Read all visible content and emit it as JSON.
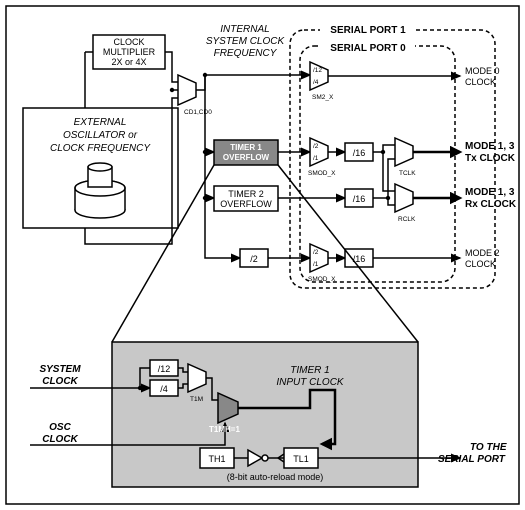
{
  "labels": {
    "clockmult1": "CLOCK",
    "clockmult2": "MULTIPLIER",
    "clockmult3": "2X or 4X",
    "cd": "CD1,CD0",
    "extosc1": "EXTERNAL",
    "extosc2": "OSCILLATOR or",
    "extosc3": "CLOCK FREQUENCY",
    "intclk1": "INTERNAL",
    "intclk2": "SYSTEM CLOCK",
    "intclk3": "FREQUENCY",
    "sp1": "SERIAL PORT 1",
    "sp0": "SERIAL PORT 0",
    "t1of1": "TIMER 1",
    "t1of2": "OVERFLOW",
    "t2of1": "TIMER 2",
    "t2of2": "OVERFLOW",
    "d12": "/12",
    "d4": "/4",
    "d2": "/2",
    "d1": "/1",
    "d16": "/16",
    "sm2x": "SM2_X",
    "smodx": "SMOD_X",
    "tclk": "TCLK",
    "rclk": "RCLK",
    "m0a": "MODE 0",
    "m0b": "CLOCK",
    "m13txa": "MODE 1, 3",
    "m13txb": "Tx CLOCK",
    "m13rxa": "MODE 1, 3",
    "m13rxb": "Rx CLOCK",
    "m2a": "MODE 2",
    "m2b": "CLOCK",
    "sysclk1": "SYSTEM",
    "sysclk2": "CLOCK",
    "oscclk1": "OSC",
    "oscclk2": "CLOCK",
    "t1m": "T1M",
    "t1mh": "T1MH=1",
    "t1in1": "TIMER 1",
    "t1in2": "INPUT CLOCK",
    "th1": "TH1",
    "tl1": "TL1",
    "reload": "(8-bit auto-reload mode)",
    "tosp1": "TO THE",
    "tosp2": "SERIAL PORT"
  }
}
